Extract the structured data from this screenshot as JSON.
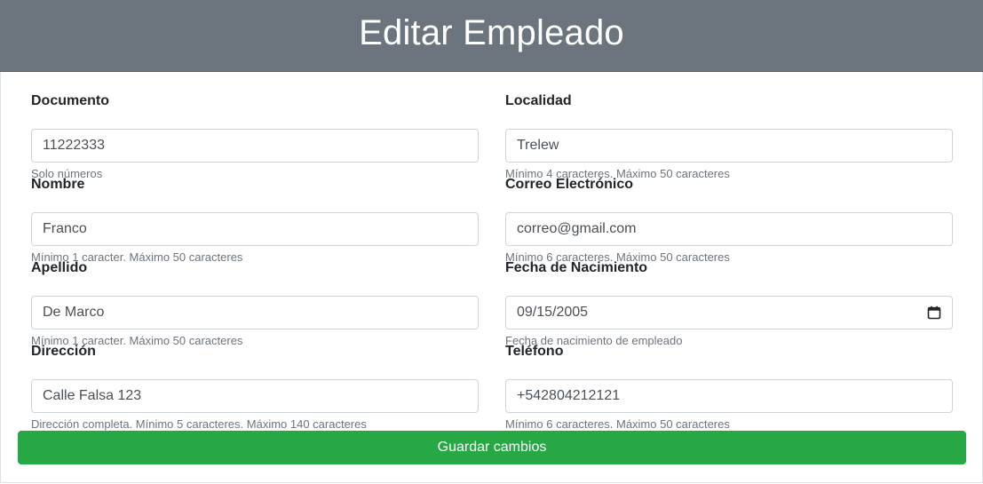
{
  "page": {
    "title": "Editar Empleado"
  },
  "form": {
    "documento": {
      "label": "Documento",
      "value": "11222333",
      "help": "Solo números"
    },
    "nombre": {
      "label": "Nombre",
      "value": "Franco",
      "help": "Mínimo 1 caracter. Máximo 50 caracteres"
    },
    "apellido": {
      "label": "Apellido",
      "value": "De Marco",
      "help": "Mínimo 1 caracter. Máximo 50 caracteres"
    },
    "direccion": {
      "label": "Dirección",
      "value": "Calle Falsa 123",
      "help": "Dirección completa. Mínimo 5 caracteres. Máximo 140 caracteres"
    },
    "localidad": {
      "label": "Localidad",
      "value": "Trelew",
      "help": "Mínimo 4 caracteres. Máximo 50 caracteres"
    },
    "correo": {
      "label": "Correo Electrónico",
      "value": "correo@gmail.com",
      "help": "Mínimo 6 caracteres. Máximo 50 caracteres"
    },
    "fecha_nacimiento": {
      "label": "Fecha de Nacimiento",
      "value": "09/15/2005",
      "help": "Fecha de nacimiento de empleado",
      "icon": "calendar-icon"
    },
    "telefono": {
      "label": "Teléfono",
      "value": "+542804212121",
      "help": "Mínimo 6 caracteres. Máximo 50 caracteres"
    },
    "submit_label": "Guardar cambios"
  },
  "colors": {
    "header_bg": "#6c757d",
    "button_bg": "#28a745"
  }
}
